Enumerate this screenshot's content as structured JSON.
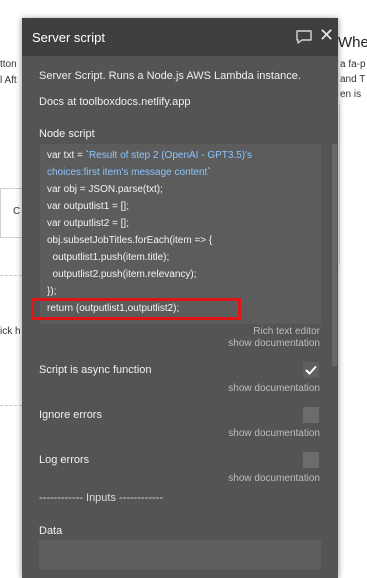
{
  "background": {
    "snippets": [
      "tton",
      "l Aft",
      "ick h",
      "C"
    ],
    "right_snippets": [
      "a fa-p",
      "and T",
      "en is"
    ],
    "when_label": "Whe"
  },
  "panel": {
    "title": "Server script",
    "description": "Server Script. Runs a Node.js AWS Lambda instance.",
    "docs": "Docs at toolboxdocs.netlify.app",
    "node_script_label": "Node script",
    "code": {
      "line1_prefix": "var txt = `",
      "line1_dynamic": "Result of step 2 (OpenAI - GPT3.5)'s",
      "line2_dynamic": "choices:first item's message content",
      "line2_suffix": "`",
      "line3": "var obj = JSON.parse(txt);",
      "line4": "var outputlist1 = [];",
      "line5": "var outputlist2 = [];",
      "line6": "obj.subsetJobTitles.forEach(item => {",
      "line7": "  outputlist1.push(item.title);",
      "line8": "  outputlist2.push(item.relevancy);",
      "line9": "});",
      "line10": "return (outputlist1,outputlist2);"
    },
    "rich_text_editor": "Rich text editor",
    "show_documentation": "show documentation",
    "async_label": "Script is async function",
    "async_checked": true,
    "ignore_errors_label": "Ignore errors",
    "ignore_errors_checked": false,
    "log_errors_label": "Log errors",
    "log_errors_checked": false,
    "inputs_separator": "------------ Inputs ------------",
    "data_label": "Data"
  },
  "colors": {
    "panel_bg": "#545454",
    "header_bg": "#3f3f3f",
    "dynamic_text": "#8ec5ff",
    "highlight_border": "#e01515"
  }
}
